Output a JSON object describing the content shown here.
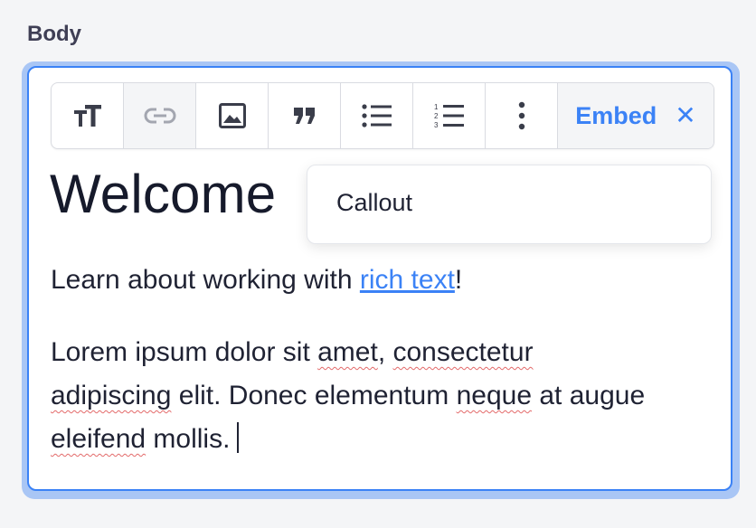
{
  "field": {
    "label": "Body"
  },
  "toolbar": {
    "buttons": [
      {
        "icon": "text-size-icon"
      },
      {
        "icon": "link-icon",
        "disabled": true
      },
      {
        "icon": "image-icon"
      },
      {
        "icon": "quote-icon"
      },
      {
        "icon": "bulleted-list-icon"
      },
      {
        "icon": "numbered-list-icon"
      },
      {
        "icon": "more-vertical-icon"
      }
    ],
    "embed_label": "Embed",
    "embed_close": "✕"
  },
  "dropdown": {
    "items": [
      "Callout"
    ]
  },
  "content": {
    "heading": "Welcome",
    "p1_before": "Learn about working with ",
    "p1_link": "rich text",
    "p1_after": "!",
    "p2": {
      "w1": "Lorem ipsum dolor sit ",
      "w2": "amet",
      "w3": ", ",
      "w4": "consectetur",
      "w5": "adipiscing",
      "w6": " elit. Donec elementum ",
      "w7": "neque",
      "w8": " at augue ",
      "w9": "eleifend",
      "w10": " mollis."
    }
  },
  "colors": {
    "accent": "#3b82f6",
    "text": "#1f2233",
    "label": "#3f3f55"
  }
}
